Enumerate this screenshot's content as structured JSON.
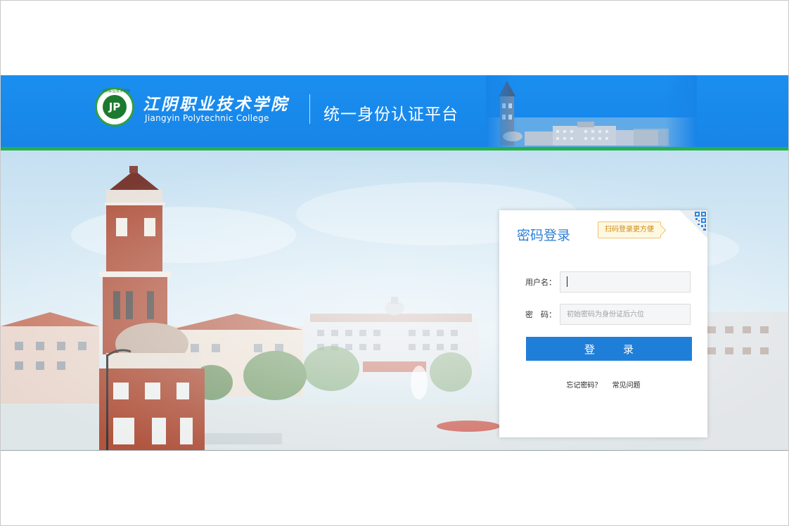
{
  "header": {
    "logo_text": "JP",
    "logo_ring_text": "江阴职业技术学院",
    "school_name_cn": "江阴职业技术学院",
    "school_name_en": "Jiangyin Polytechnic College",
    "platform_title": "统一身份认证平台"
  },
  "login": {
    "title": "密码登录",
    "qr_tip": "扫码登录更方便",
    "qr_icon": "qr-code-icon",
    "username_label": "用户名：",
    "username_value": "",
    "password_label": "密　码：",
    "password_placeholder": "初始密码为身份证后六位",
    "submit_label": "登录",
    "forgot_password": "忘记密码？",
    "faq": "常见问题"
  },
  "colors": {
    "header_blue": "#1784e8",
    "accent_green": "#22b14c",
    "button_blue": "#1f7fd8",
    "title_blue": "#2f7fd6",
    "tip_orange": "#d28a12"
  }
}
